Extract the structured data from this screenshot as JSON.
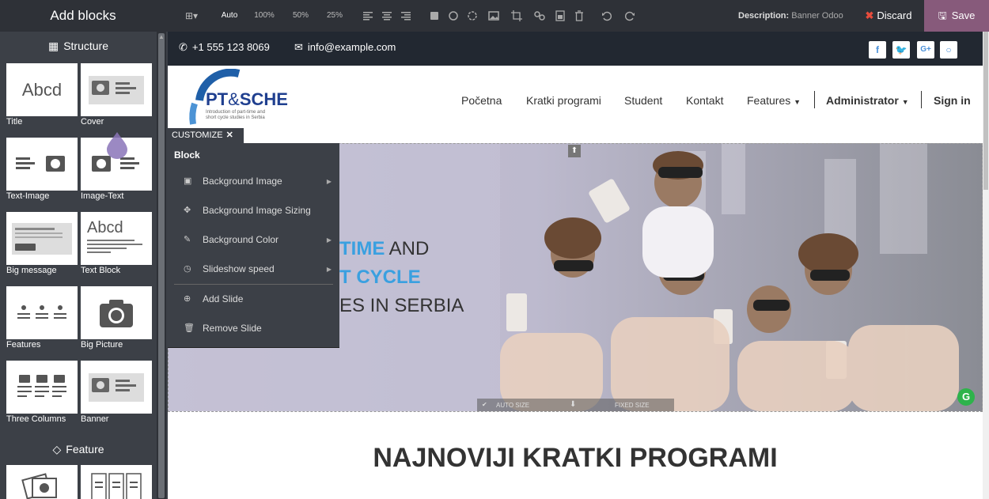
{
  "sidebar": {
    "title": "Add blocks",
    "sections": [
      {
        "label": "Structure",
        "icon": "grid-icon"
      },
      {
        "label": "Feature",
        "icon": "diamond-icon"
      }
    ],
    "blocks": [
      {
        "label": "Title",
        "preview": "Abcd"
      },
      {
        "label": "Cover"
      },
      {
        "label": "Text-Image"
      },
      {
        "label": "Image-Text"
      },
      {
        "label": "Big message"
      },
      {
        "label": "Text Block",
        "preview": "Abcd"
      },
      {
        "label": "Features"
      },
      {
        "label": "Big Picture"
      },
      {
        "label": "Three Columns"
      },
      {
        "label": "Banner"
      }
    ]
  },
  "toolbar": {
    "zoom_options": [
      "Auto",
      "100%",
      "50%",
      "25%"
    ],
    "active_zoom": "Auto",
    "description_label": "Description:",
    "description_value": "Banner Odoo",
    "discard_label": "Discard",
    "save_label": "Save"
  },
  "page": {
    "topbar": {
      "phone": "+1 555 123 8069",
      "email": "info@example.com",
      "social": [
        "f",
        "t",
        "G+",
        "gh"
      ]
    },
    "logo": {
      "name_part1": "PT",
      "name_amp": "&",
      "name_part2": "SCHE",
      "tagline1": "Introduction of part-time and",
      "tagline2": "short cycle studies in Serbia"
    },
    "nav": {
      "items": [
        "Početna",
        "Kratki programi",
        "Student",
        "Kontakt"
      ],
      "features": "Features",
      "administrator": "Administrator",
      "signin": "Sign in"
    },
    "hero": {
      "line1_blue": "TIME",
      "line1_rest": " AND",
      "line2_blue": "T CYCLE",
      "line3": "ES IN SERBIA"
    },
    "heading": "NAJNOVIJI KRATKI PROGRAMI",
    "resize": {
      "auto": "AUTO SIZE",
      "fixed": "FIXED SIZE"
    }
  },
  "customize": {
    "tab_label": "CUSTOMIZE",
    "header": "Block",
    "items": [
      {
        "label": "Background Image",
        "icon": "image-icon",
        "submenu": true
      },
      {
        "label": "Background Image Sizing",
        "icon": "move-icon",
        "submenu": false
      },
      {
        "label": "Background Color",
        "icon": "eyedropper-icon",
        "submenu": true
      },
      {
        "label": "Slideshow speed",
        "icon": "clock-icon",
        "submenu": true
      },
      {
        "label": "Add Slide",
        "icon": "plus-circle-icon",
        "submenu": false
      },
      {
        "label": "Remove Slide",
        "icon": "trash-icon",
        "submenu": false
      }
    ]
  },
  "colors": {
    "save_bg": "#875a7b",
    "accent_blue": "#3aa0e0",
    "discard_x": "#e74c3c"
  }
}
